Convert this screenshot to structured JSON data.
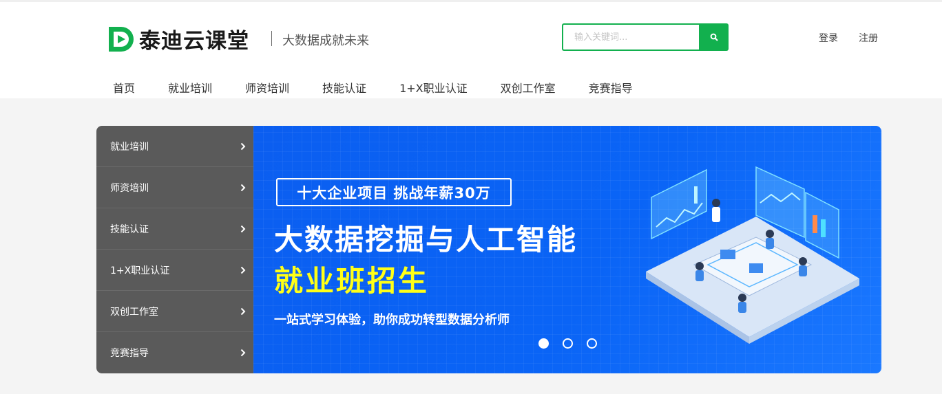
{
  "brand": {
    "name": "泰迪云课堂",
    "slogan": "大数据成就未来",
    "color": "#12b04e"
  },
  "search": {
    "placeholder": "输入关键词...",
    "icon": "search-icon"
  },
  "auth": {
    "login": "登录",
    "register": "注册"
  },
  "nav": [
    "首页",
    "就业培训",
    "师资培训",
    "技能认证",
    "1+X职业认证",
    "双创工作室",
    "竞赛指导"
  ],
  "side_menu": [
    "就业培训",
    "师资培训",
    "技能认证",
    "1+X职业认证",
    "双创工作室",
    "竞赛指导"
  ],
  "banner": {
    "tagline": "十大企业项目 挑战年薪30万",
    "title_line1": "大数据挖掘与人工智能",
    "title_line2": "就业班招生",
    "subtitle": "一站式学习体验，助你成功转型数据分析师",
    "slide_count": 3,
    "active_slide": 1
  }
}
